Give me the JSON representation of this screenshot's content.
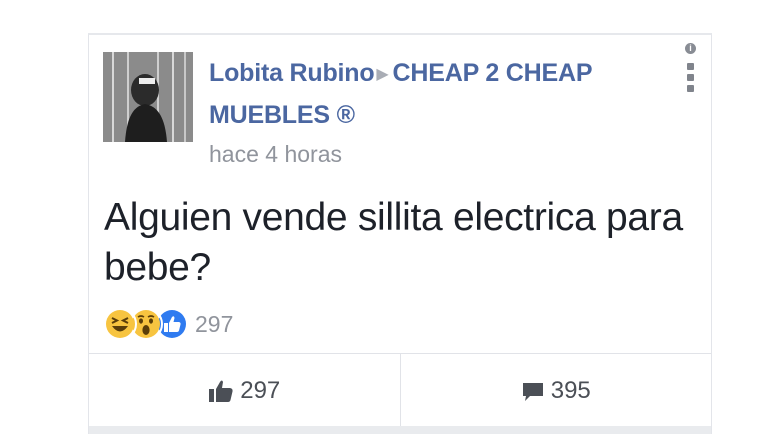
{
  "post": {
    "author": "Lobita Rubino",
    "group_line1": "CHEAP 2 CHEAP",
    "group_line2": "MUEBLES ®",
    "timestamp": "hace 4 horas",
    "text": "Alguien vende sillita electrica para bebe?",
    "reactions": {
      "icons": [
        "laugh-reaction",
        "wow-reaction",
        "like-reaction"
      ],
      "count": "297"
    }
  },
  "actions": {
    "like_count": "297",
    "comment_count": "395"
  },
  "colors": {
    "link_blue": "#4b67a1",
    "meta_gray": "#90949c",
    "text_dark": "#1d2129",
    "like_blue": "#2f7bf0",
    "emoji_yellow": "#f7c440"
  }
}
